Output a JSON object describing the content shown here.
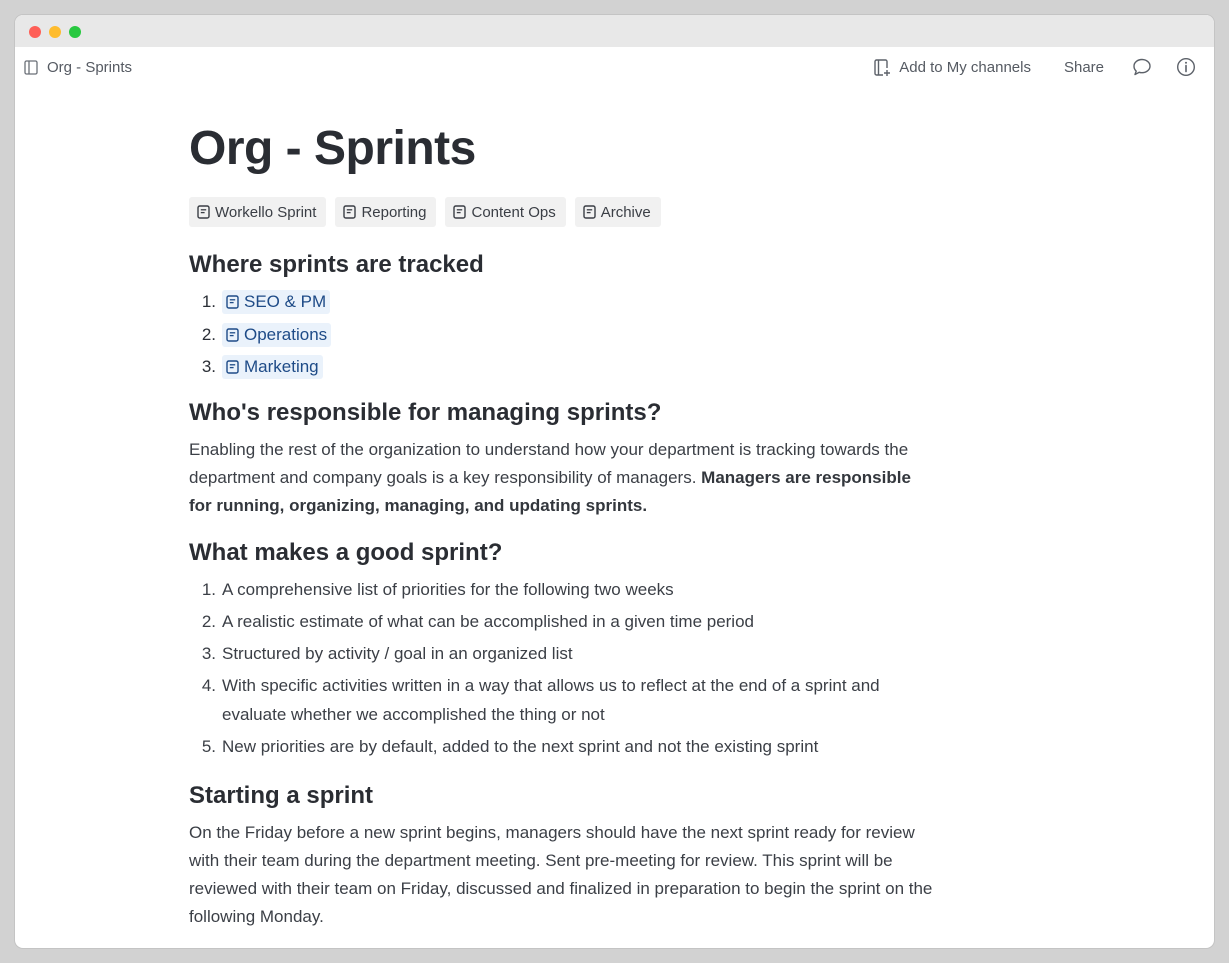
{
  "window": {
    "breadcrumb": "Org - Sprints"
  },
  "toolbar": {
    "add_label": "Add to My channels",
    "share_label": "Share"
  },
  "page": {
    "title": "Org - Sprints",
    "chips": [
      "Workello Sprint",
      "Reporting",
      "Content Ops",
      "Archive"
    ]
  },
  "sections": {
    "where": {
      "heading": "Where sprints are tracked",
      "items": [
        {
          "num": "1.",
          "label": "SEO & PM"
        },
        {
          "num": "2.",
          "label": "Operations"
        },
        {
          "num": "3.",
          "label": "Marketing"
        }
      ]
    },
    "who": {
      "heading": "Who's responsible for managing sprints?",
      "text": "Enabling the rest of the organization to understand how your department is tracking towards the department and company goals is a key responsibility of managers. ",
      "bold": "Managers are responsible for running, organizing, managing, and updating sprints."
    },
    "what": {
      "heading": "What makes a good sprint?",
      "items": [
        {
          "num": "1.",
          "text": "A comprehensive list of priorities for the following two weeks"
        },
        {
          "num": "2.",
          "text": "A realistic estimate of what can be accomplished in a given time period"
        },
        {
          "num": "3.",
          "text": "Structured by activity / goal in an organized list"
        },
        {
          "num": "4.",
          "text": "With specific activities written in a way that allows us to reflect at the end of a sprint and evaluate whether we accomplished the thing or not"
        },
        {
          "num": "5.",
          "text": "New priorities are by default, added to the next sprint and not the existing sprint"
        }
      ]
    },
    "start": {
      "heading": "Starting a sprint",
      "text": "On the Friday before a new sprint begins, managers should have the next sprint ready for review with their team during the department meeting. Sent pre-meeting for review.  This sprint will be reviewed with their team on Friday, discussed and finalized in preparation to begin the sprint on the following Monday."
    }
  },
  "colors": {
    "link_bg": "#eaf2fb",
    "link_text": "#1e4b87",
    "chip_bg": "#f1f1f1"
  }
}
